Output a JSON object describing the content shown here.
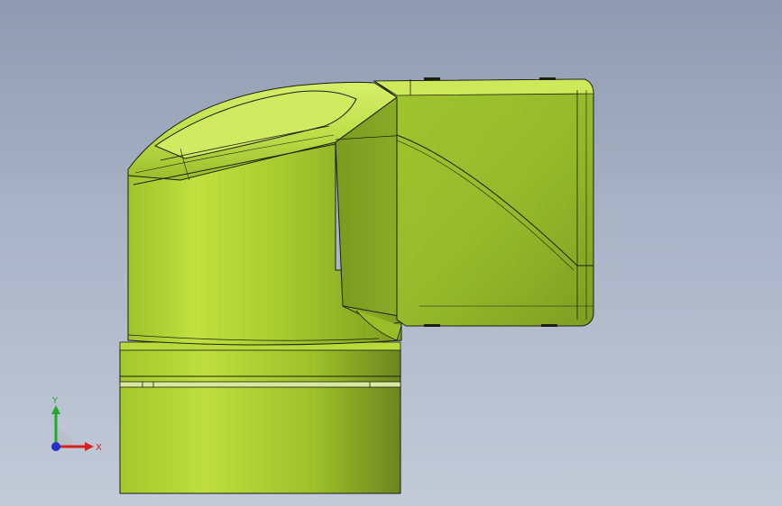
{
  "viewport": {
    "background_top": "#8e9bb0",
    "background_bottom": "#c3cad8"
  },
  "model": {
    "body_color": "#a6cc2e",
    "highlight_color": "#cfe866",
    "shadow_color": "#6f8a1c",
    "edge_color": "#1a1f10"
  },
  "triad": {
    "x_label": "X",
    "y_label": "Y",
    "x_color": "#d42020",
    "y_color": "#22a82a",
    "z_color": "#2030c8"
  }
}
